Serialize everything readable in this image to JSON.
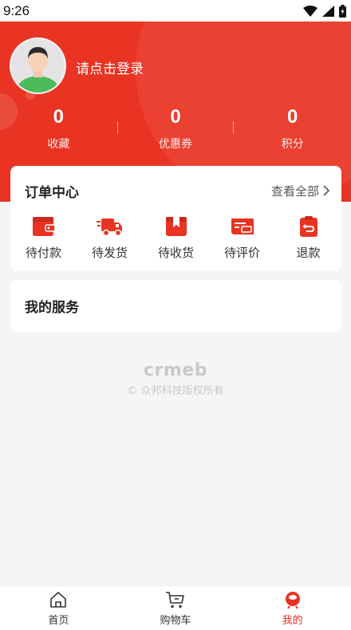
{
  "status": {
    "time": "9:26"
  },
  "user": {
    "login_prompt": "请点击登录"
  },
  "stats": [
    {
      "value": "0",
      "label": "收藏"
    },
    {
      "value": "0",
      "label": "优惠券"
    },
    {
      "value": "0",
      "label": "积分"
    }
  ],
  "orders": {
    "title": "订单中心",
    "view_all": "查看全部",
    "items": [
      {
        "label": "待付款",
        "icon": "wallet-icon"
      },
      {
        "label": "待发货",
        "icon": "delivery-truck-icon"
      },
      {
        "label": "待收货",
        "icon": "package-box-icon"
      },
      {
        "label": "待评价",
        "icon": "review-card-icon"
      },
      {
        "label": "退款",
        "icon": "refund-icon"
      }
    ]
  },
  "services": {
    "title": "我的服务"
  },
  "footer": {
    "logo": "crmeb",
    "copyright": "众邦科技版权所有"
  },
  "tabbar": [
    {
      "label": "首页",
      "icon": "home-icon"
    },
    {
      "label": "购物车",
      "icon": "cart-icon"
    },
    {
      "label": "我的",
      "icon": "profile-icon",
      "active": true
    }
  ],
  "colors": {
    "brand": "#e93323",
    "background": "#f5f5f5"
  }
}
